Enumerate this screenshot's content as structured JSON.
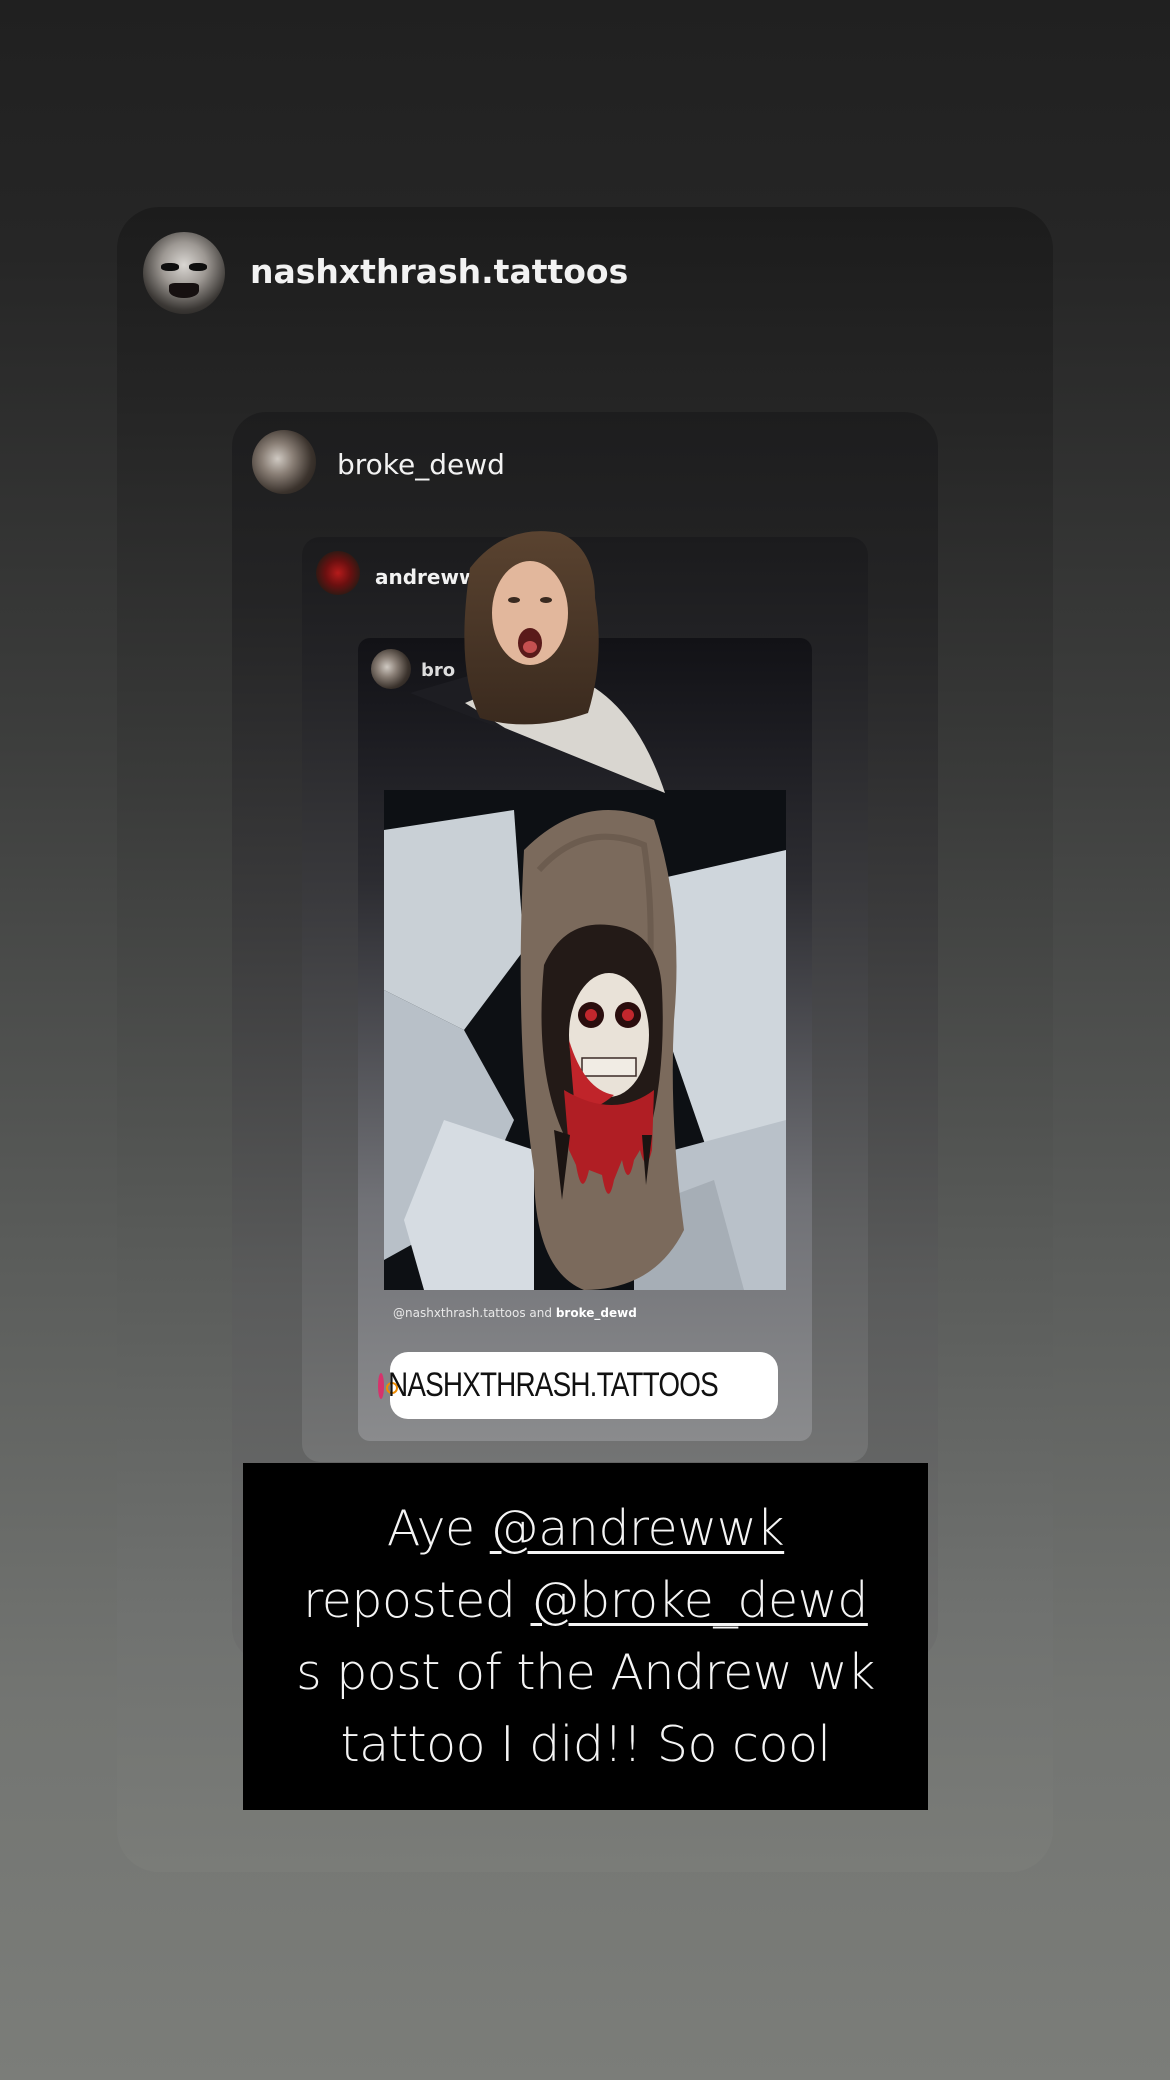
{
  "story": {
    "outer": {
      "username": "nashxthrash.tattoos"
    },
    "second": {
      "username": "broke_dewd"
    },
    "third": {
      "username": "andrewwk",
      "verified": true
    },
    "fourth": {
      "username_partial": "bro"
    },
    "photo_caption": {
      "handle_1": "@nashxthrash.tattoos",
      "joiner": "and",
      "handle_2": "broke_dewd"
    },
    "handle_sticker": {
      "text": "NASHXTHRASH.TATTOOS",
      "icon": "threads-at-icon"
    },
    "text_box": {
      "prefix": "Aye ",
      "mention_1": "@andrewwk",
      "middle": " reposted ",
      "mention_2": "@broke_dewd",
      "suffix": " s post of the Andrew wk tattoo I did!! So cool"
    }
  },
  "colors": {
    "background_top": "#202020",
    "background_bottom": "#7b7d79",
    "caption_box": "#000000",
    "sticker_bg": "#ffffff",
    "text": "#f2f2f2"
  }
}
